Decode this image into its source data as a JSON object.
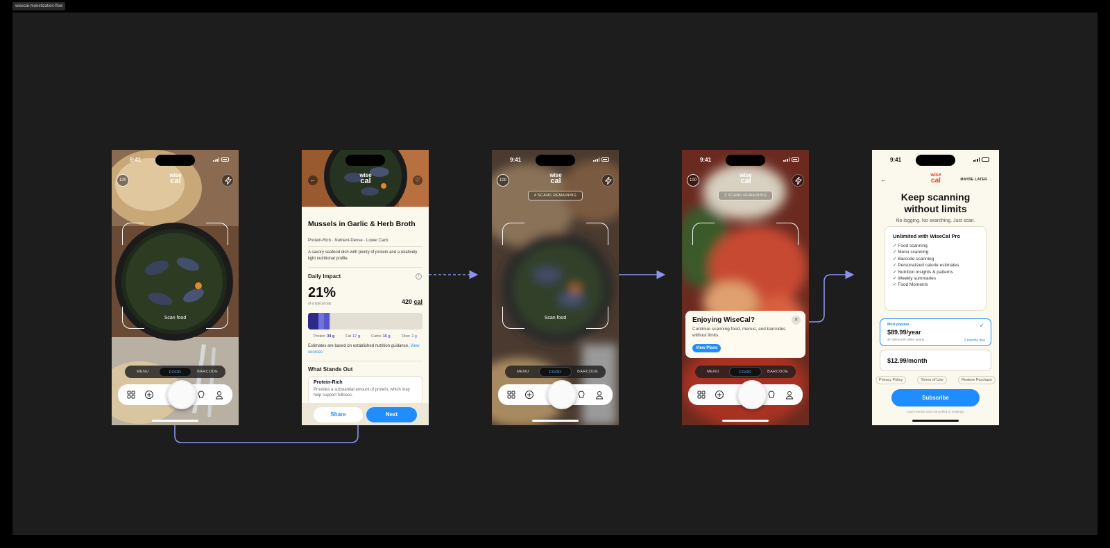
{
  "canvas": {
    "frame_label": "wisecal-monetization-flow",
    "background": "#1d1d1d",
    "arrow_color": "#8a94f0"
  },
  "brand": {
    "logo_top": "wise",
    "logo_bottom": "cal",
    "accent": "#1f8cff",
    "logo_color": "#e0452c"
  },
  "scanner": {
    "time": "9:41",
    "scan_count": "100",
    "scan_label": "Scan food",
    "modes": [
      "MENU",
      "FOOD",
      "BARCODE"
    ],
    "active_mode": "FOOD",
    "toolbar_icons": [
      "grid-icon",
      "plus-circle-icon",
      "shutter-button",
      "lightbulb-icon",
      "profile-icon"
    ]
  },
  "detail": {
    "title": "Mussels in Garlic & Herb Broth",
    "tags": "Protein-Rich · Nutrient-Dense · Lower Carb",
    "description": "A savory seafood dish with plenty of protein and a relatively light nutritional profile.",
    "daily_impact_title": "Daily Impact",
    "info": "i",
    "percent": "21%",
    "percent_sub": "of a typical day",
    "calories_value": "420",
    "calories_unit": "cal",
    "macros": [
      {
        "label": "Protein",
        "value": "34 g",
        "grams": 34,
        "color": "#2e2a8c"
      },
      {
        "label": "Fat",
        "value": "17 g",
        "grams": 17,
        "color": "#7272d8"
      },
      {
        "label": "Carbs",
        "value": "16 g",
        "grams": 16,
        "color": "#5555c8"
      },
      {
        "label": "Fiber",
        "value": "2 g",
        "grams": 2,
        "color": "#8a8ae0"
      }
    ],
    "estimate_text": "Estimates are based on established nutrition guidance.",
    "view_sources": "View sources",
    "stands_out_title": "What Stands Out",
    "stand_card_title": "Protein-Rich",
    "stand_card_text": "Provides a substantial amount of protein, which may help support fullness.",
    "share_label": "Share",
    "next_label": "Next"
  },
  "limited_scanner": {
    "scans_remaining_a": "4 SCANS REMAINING",
    "scans_remaining_b": "3 SCANS REMAINING"
  },
  "popup": {
    "title": "Enjoying WiseCal?",
    "text": "Continue scanning food, menus, and barcodes without limits.",
    "cta": "View Plans",
    "close": "✕"
  },
  "paywall": {
    "time": "9:41",
    "maybe_later": "MAYBE LATER →",
    "title_line1": "Keep scanning",
    "title_line2": "without limits",
    "subtitle": "No logging. No searching. Just scan.",
    "features_title": "Unlimited with WiseCal Pro",
    "features": [
      "✓ Food scanning",
      "✓ Menu scanning",
      "✓ Barcode scanning",
      "✓ Personalized calorie estimates",
      "✓ Nutrition insights & patterns",
      "✓ Weekly summaries",
      "✓ Food Moments"
    ],
    "plan_year_badge": "Most popular",
    "plan_year_price": "$89.99/year",
    "plan_year_note": "$7.49/month billed yearly",
    "plan_year_free": "2 months free",
    "plan_month_price": "$12.99/month",
    "links": [
      "Privacy Policy",
      "Terms of Use",
      "Restore Purchase"
    ],
    "subscribe": "Subscribe",
    "autorenew": "Auto-renews until cancelled in Settings."
  }
}
